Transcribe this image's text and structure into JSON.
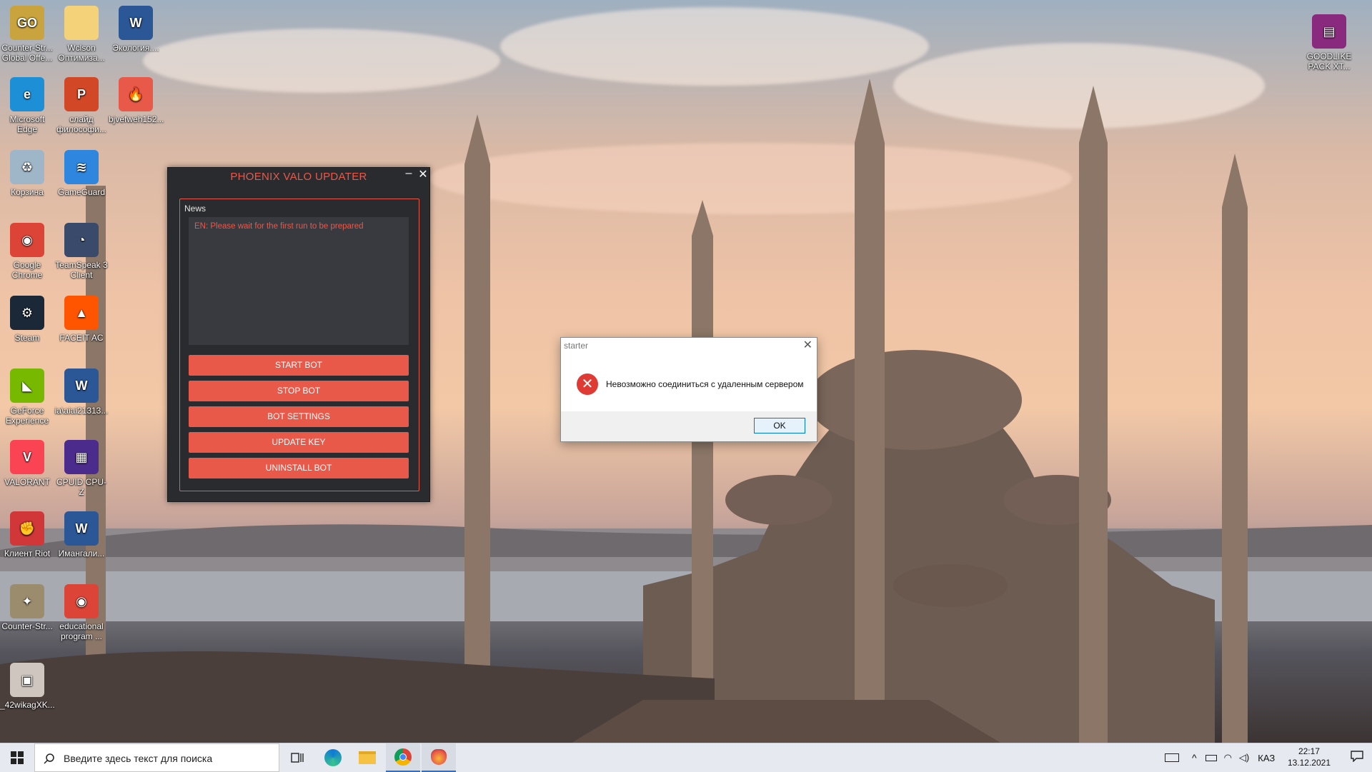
{
  "desktop": {
    "icons": [
      {
        "label": "Counter-Str... Global Offe...",
        "icon": "csgo-icon"
      },
      {
        "label": "Wclson Оптимиза...",
        "icon": "folder-icon"
      },
      {
        "label": "Экология....",
        "icon": "word-doc-icon"
      },
      {
        "label": "Microsoft Edge",
        "icon": "edge-icon"
      },
      {
        "label": "слайд философи...",
        "icon": "powerpoint-doc-icon"
      },
      {
        "label": "bjvefweh152...",
        "icon": "phoenix-icon"
      },
      {
        "label": "Корзина",
        "icon": "recycle-bin-icon"
      },
      {
        "label": "GameGuard",
        "icon": "gameguard-icon"
      },
      {
        "label": "Google Chrome",
        "icon": "chrome-icon"
      },
      {
        "label": "TeamSpeak 3 Client",
        "icon": "teamspeak-icon"
      },
      {
        "label": "Steam",
        "icon": "steam-icon"
      },
      {
        "label": "FACEIT AC",
        "icon": "faceit-icon"
      },
      {
        "label": "GeForce Experience",
        "icon": "geforce-icon"
      },
      {
        "label": "ia\\aiai21313...",
        "icon": "word-doc-icon"
      },
      {
        "label": "VALORANT",
        "icon": "valorant-icon"
      },
      {
        "label": "CPUID CPU-Z",
        "icon": "cpuz-icon"
      },
      {
        "label": "Клиент Riot",
        "icon": "riot-client-icon"
      },
      {
        "label": "Имангали...",
        "icon": "word-doc-icon"
      },
      {
        "label": "Counter-Str...",
        "icon": "cs-icon"
      },
      {
        "label": "educational program ...",
        "icon": "chrome-icon"
      },
      {
        "label": "_42wikagXK...",
        "icon": "image-file-icon"
      },
      {
        "label": "GOODLIKE PACK XT...",
        "icon": "winrar-icon"
      }
    ]
  },
  "phoenix": {
    "title": "PHOENIX VALO UPDATER",
    "minimize": "–",
    "close": "✕",
    "news_label": "News",
    "news_text": "EN: Please wait for the first run to be prepared",
    "buttons": [
      "START BOT",
      "STOP BOT",
      "BOT SETTINGS",
      "UPDATE KEY",
      "UNINSTALL BOT"
    ]
  },
  "dialog": {
    "title": "starter",
    "close": "✕",
    "icon": "error-icon",
    "message": "Невозможно соединиться с удаленным сервером",
    "ok": "OK"
  },
  "taskbar": {
    "search_placeholder": "Введите здесь текст для поиска",
    "apps": [
      "task-view-icon",
      "edge-icon",
      "file-explorer-icon",
      "chrome-icon",
      "phoenix-icon"
    ],
    "language": "КАЗ",
    "time": "22:17",
    "date": "13.12.2021"
  },
  "colors": {
    "accent": "#e8594a",
    "window_bg": "#2a2b2f",
    "taskbar_bg": "#e6e9ef"
  }
}
